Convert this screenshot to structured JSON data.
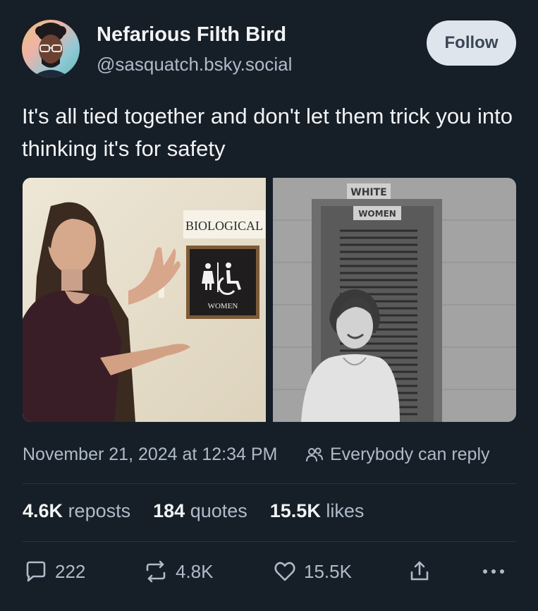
{
  "author": {
    "display_name": "Nefarious Filth Bird",
    "handle": "@sasquatch.bsky.social"
  },
  "follow_label": "Follow",
  "post": {
    "text": "It's all tied together and don't let them trick you into thinking it's for safety",
    "images": [
      {
        "sign_top": "BIOLOGICAL",
        "sign_label": "WOMEN"
      },
      {
        "sign_top": "WHITE",
        "sign_label": "WOMEN"
      }
    ]
  },
  "meta": {
    "timestamp": "November 21, 2024 at 12:34 PM",
    "reply_setting": "Everybody can reply"
  },
  "stats": {
    "reposts_count": "4.6K",
    "reposts_label": "reposts",
    "quotes_count": "184",
    "quotes_label": "quotes",
    "likes_count": "15.5K",
    "likes_label": "likes"
  },
  "actions": {
    "reply_count": "222",
    "repost_count": "4.8K",
    "like_count": "15.5K"
  },
  "icons": {
    "reply": "speech-bubble-icon",
    "repost": "repost-arrows-icon",
    "like": "heart-icon",
    "share": "share-upload-icon",
    "more": "ellipsis-icon",
    "reply_setting": "people-icon"
  },
  "colors": {
    "background": "#161e27",
    "text_primary": "#f1f3f5",
    "text_secondary": "#aebbc9",
    "follow_bg": "#dfe5ec"
  }
}
